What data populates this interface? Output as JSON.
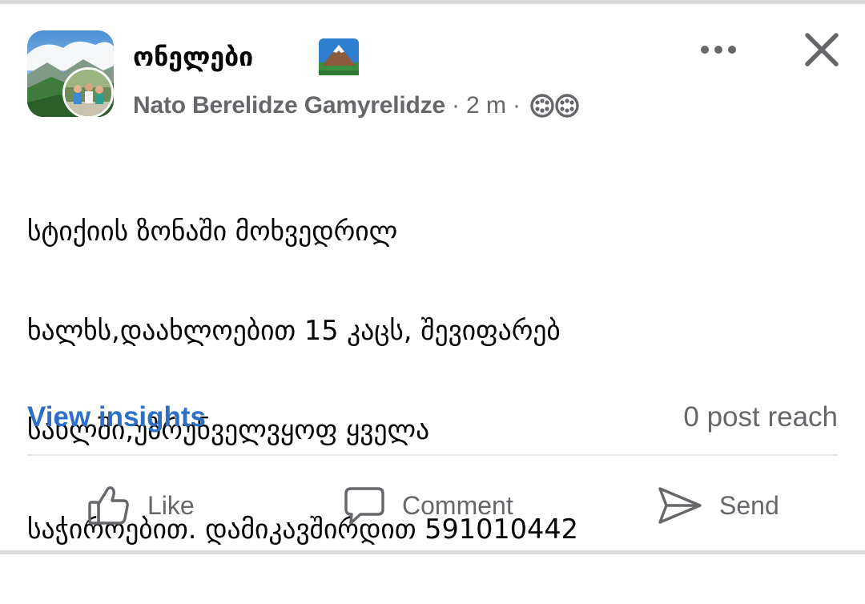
{
  "post": {
    "group_name": "ონელები",
    "author": "Nato Berelidze Gamyrelidze",
    "separator": "·",
    "time": "2 m",
    "audience_icon": "members-icon",
    "body_lines": [
      "სტიქიის ზონაში მოხვედრილ",
      "ხალხს,დაახლოებით 15 კაცს, შევიფარებ",
      "სახლში,უზრუნველვყოფ ყველა",
      "საჭიროებით. დამიკავშირდით 591010442"
    ]
  },
  "insights": {
    "view_label": "View insights",
    "reach_label": "0 post reach"
  },
  "actions": {
    "like": "Like",
    "comment": "Comment",
    "send": "Send"
  },
  "colors": {
    "link": "#2d6fc8",
    "secondary_text": "#65676b",
    "primary_text": "#050505",
    "divider": "#e4e6eb"
  }
}
